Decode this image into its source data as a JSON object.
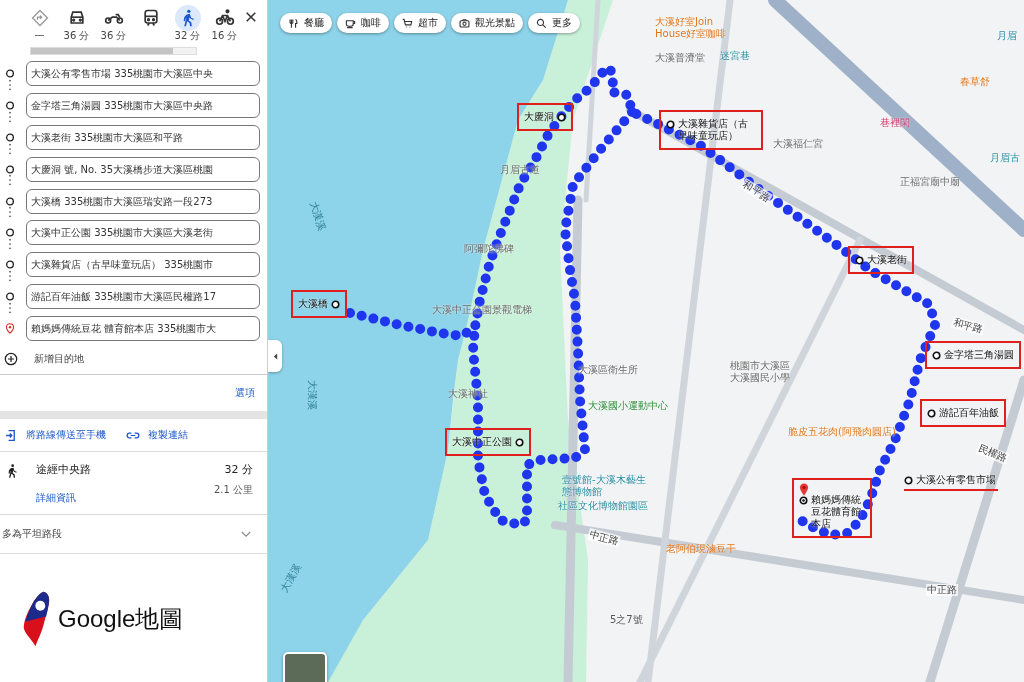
{
  "sidebar": {
    "travel_modes": [
      {
        "kind": "best",
        "label": "—",
        "selected": false
      },
      {
        "kind": "car",
        "label": "36 分",
        "selected": false
      },
      {
        "kind": "motorcycle",
        "label": "36 分",
        "selected": false
      },
      {
        "kind": "transit",
        "selected": false
      },
      {
        "kind": "walk",
        "label": "32 分",
        "selected": true
      },
      {
        "kind": "bicycle",
        "label": "16 分",
        "selected": false
      }
    ],
    "stops": [
      {
        "kind": "waypoint",
        "text": "大溪公有零售市場 335桃園市大溪區中央"
      },
      {
        "kind": "waypoint",
        "text": "金字塔三角湯圓 335桃園市大溪區中央路"
      },
      {
        "kind": "waypoint",
        "text": "大溪老街 335桃園市大溪區和平路"
      },
      {
        "kind": "waypoint",
        "text": "大慶洞 號, No. 35大溪橋步道大溪區桃園"
      },
      {
        "kind": "waypoint",
        "text": "大溪橋 335桃園市大溪區瑞安路一段273"
      },
      {
        "kind": "waypoint",
        "text": "大溪中正公園 335桃園市大溪區大溪老街"
      },
      {
        "kind": "waypoint",
        "text": "大溪雜貨店（古早味童玩店） 335桃園市"
      },
      {
        "kind": "waypoint",
        "text": "游記百年油飯 335桃園市大溪區民權路17"
      },
      {
        "kind": "destination",
        "text": "賴媽媽傳統豆花 體育館本店 335桃園市大"
      }
    ],
    "add_destination": "新增目的地",
    "options_link": "選項",
    "actions": [
      {
        "kind": "send",
        "label": "將路線傳送至手機"
      },
      {
        "kind": "link",
        "label": "複製連結"
      }
    ],
    "route": {
      "title": "途經中央路",
      "duration": "32 分",
      "distance": "2.1 公里",
      "details_link": "詳細資訊"
    },
    "terrain_note": "多為平坦路段",
    "logo_text": "Google地圖"
  },
  "map": {
    "chips": [
      {
        "kind": "restaurant",
        "label": "餐廳"
      },
      {
        "kind": "coffee",
        "label": "咖啡"
      },
      {
        "kind": "cart",
        "label": "超市"
      },
      {
        "kind": "camera",
        "label": "觀光景點"
      },
      {
        "kind": "search",
        "label": "更多"
      }
    ],
    "place_labels": [
      {
        "kind": "orange",
        "text": "大溪好室Join House好室咖啡"
      },
      {
        "kind": "gray",
        "text": "大溪普濟堂"
      },
      {
        "kind": "teal",
        "text": "迷宮巷"
      },
      {
        "kind": "gray",
        "text": "大溪福仁宮"
      },
      {
        "kind": "pink",
        "text": "巷裡閑"
      },
      {
        "kind": "gray",
        "text": "正福宮廟中廟"
      },
      {
        "kind": "teal",
        "text": "月眉"
      },
      {
        "kind": "orange",
        "text": "春草舒"
      },
      {
        "kind": "teal",
        "text": "月眉古"
      },
      {
        "kind": "gray",
        "text": "月眉古道"
      },
      {
        "kind": "gray",
        "text": "阿彌陀佛碑"
      },
      {
        "kind": "gray",
        "text": "大溪中正公園景觀電梯"
      },
      {
        "kind": "gray",
        "text": "大溪神社"
      },
      {
        "kind": "gray",
        "text": "大溪區衛生所"
      },
      {
        "kind": "green",
        "text": "大溪國小運動中心"
      },
      {
        "kind": "gray",
        "text": "桃園市大溪區大溪國民小學"
      },
      {
        "kind": "teal",
        "text": "壹號館-大溪木藝生態博物館"
      },
      {
        "kind": "teal",
        "text": "社區文化博物館園區"
      },
      {
        "kind": "orange",
        "text": "老阿伯現滷豆干"
      },
      {
        "kind": "orange",
        "text": "脆皮五花肉(阿飛肉圓店)"
      },
      {
        "kind": "dark",
        "text": "5之7號"
      },
      {
        "kind": "road",
        "text": "和平路"
      },
      {
        "kind": "road",
        "text": "和平路"
      },
      {
        "kind": "road",
        "text": "中正路"
      },
      {
        "kind": "road",
        "text": "中正路"
      },
      {
        "kind": "road",
        "text": "民權路"
      },
      {
        "kind": "water",
        "text": "大漢溪"
      },
      {
        "kind": "water",
        "text": "大漢溪"
      },
      {
        "kind": "water",
        "text": "大漢溪"
      }
    ],
    "annotations": [
      {
        "kind": "box",
        "text": "大慶洞"
      },
      {
        "kind": "box",
        "text": "大溪雜貨店（古早味童玩店）"
      },
      {
        "kind": "box",
        "text": "大溪老街"
      },
      {
        "kind": "box",
        "text": "金字塔三角湯圓"
      },
      {
        "kind": "box",
        "text": "游記百年油飯"
      },
      {
        "kind": "underline",
        "text": "大溪公有零售市場"
      },
      {
        "kind": "box-destination",
        "text": "賴媽媽傳統豆花體育館本店"
      },
      {
        "kind": "box",
        "text": "大溪橋"
      },
      {
        "kind": "box",
        "text": "大溪中正公園"
      }
    ]
  }
}
